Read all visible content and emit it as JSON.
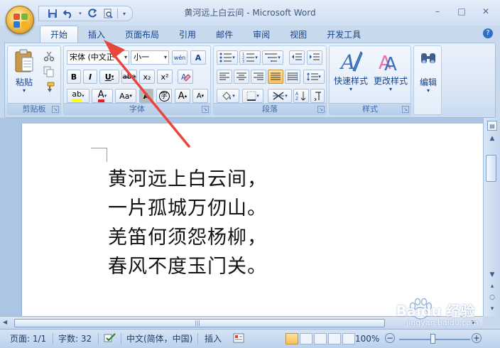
{
  "window": {
    "title": "黄河远上白云间 - Microsoft Word",
    "minimize": "–",
    "maximize": "□",
    "close": "✕"
  },
  "tabs": [
    "开始",
    "插入",
    "页面布局",
    "引用",
    "邮件",
    "审阅",
    "视图",
    "开发工具"
  ],
  "ribbon": {
    "clipboard": {
      "label": "剪贴板",
      "paste": "粘贴"
    },
    "font": {
      "label": "字体",
      "font_name": "宋体 (中文正",
      "font_size": "小一",
      "bold": "B",
      "italic": "I",
      "underline": "U",
      "strike": "abe",
      "subscript": "x₂",
      "superscript": "x²",
      "highlight": "ab",
      "font_color": "A",
      "change_case": "Aa",
      "grow": "A",
      "shrink": "A",
      "clear_format": "A",
      "phonetic": "wén",
      "char_border": "A",
      "enclose": "字"
    },
    "paragraph": {
      "label": "段落"
    },
    "styles": {
      "label": "样式",
      "quick_styles": "快速样式",
      "change_styles": "更改样式"
    },
    "editing": {
      "label": "编辑"
    }
  },
  "document": {
    "lines": [
      "黄河远上白云间，",
      "一片孤城万仞山。",
      "羌笛何须怨杨柳，",
      "春风不度玉门关。"
    ]
  },
  "statusbar": {
    "page": "页面: 1/1",
    "words": "字数: 32",
    "language": "中文(简体，中国)",
    "mode": "插入",
    "zoom": "100%"
  },
  "watermark": {
    "brand": "Baidu 经验",
    "url": "jingyan.baidu.com"
  },
  "colors": {
    "accent": "#15428b",
    "annotation": "#e8463c"
  }
}
